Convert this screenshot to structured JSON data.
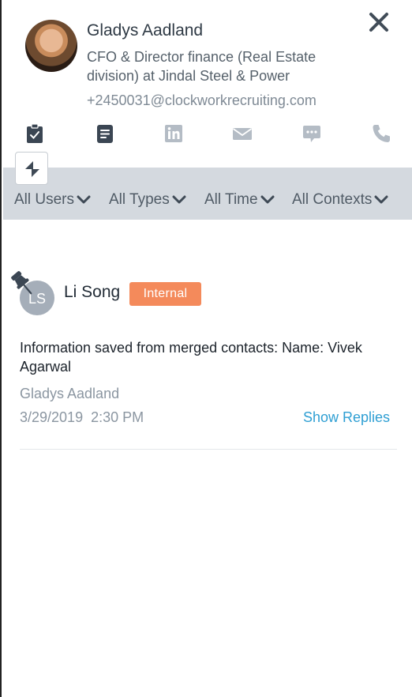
{
  "contact": {
    "name": "Gladys Aadland",
    "title": "CFO & Director finance (Real Estate division) at Jindal Steel & Power",
    "email": "+2450031@clockworkrecruiting.com"
  },
  "actions": [
    {
      "name": "clipboard-check-icon"
    },
    {
      "name": "document-icon"
    },
    {
      "name": "linkedin-icon"
    },
    {
      "name": "mail-icon"
    },
    {
      "name": "chat-icon"
    },
    {
      "name": "phone-icon"
    }
  ],
  "filters": {
    "users": "All Users",
    "types": "All Types",
    "time": "All Time",
    "contexts": "All Contexts"
  },
  "note": {
    "author": "Li Song",
    "author_initials": "LS",
    "badge": "Internal",
    "text": "Information saved from merged contacts: Name: Vivek Agarwal",
    "owner": "Gladys Aadland",
    "date": "3/29/2019  2:30 PM",
    "show_replies": "Show Replies"
  },
  "colors": {
    "accent_link": "#2f9fd3",
    "badge": "#f48a5b",
    "filter_bar": "#d4d9df",
    "icon_dark": "#3b4653",
    "icon_light": "#b4bcc5"
  }
}
